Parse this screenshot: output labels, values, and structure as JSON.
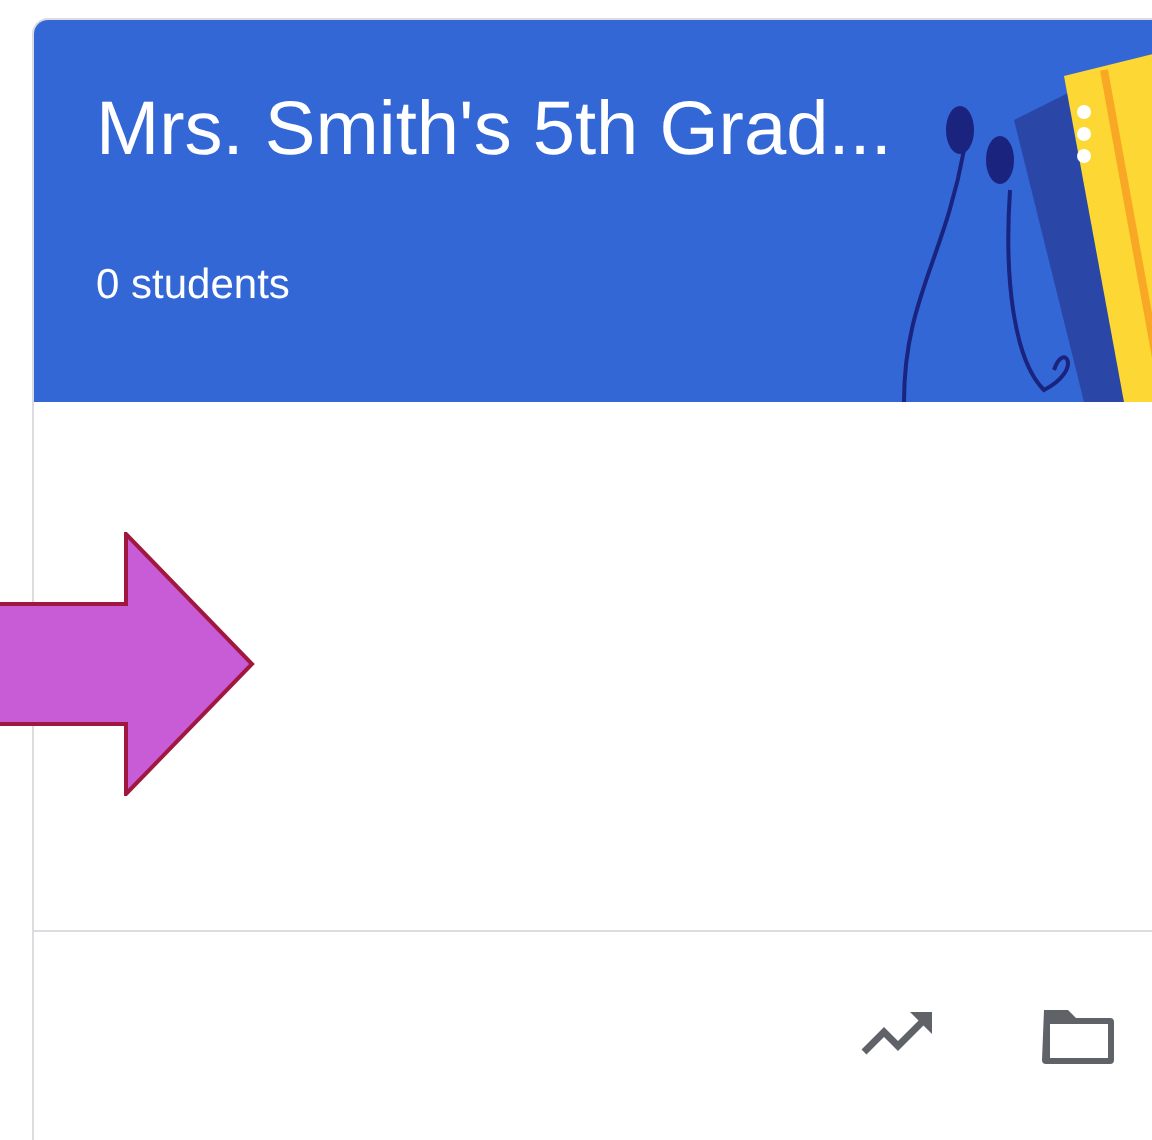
{
  "class_card": {
    "title": "Mrs. Smith's 5th Grad...",
    "subtitle": "0 students"
  }
}
